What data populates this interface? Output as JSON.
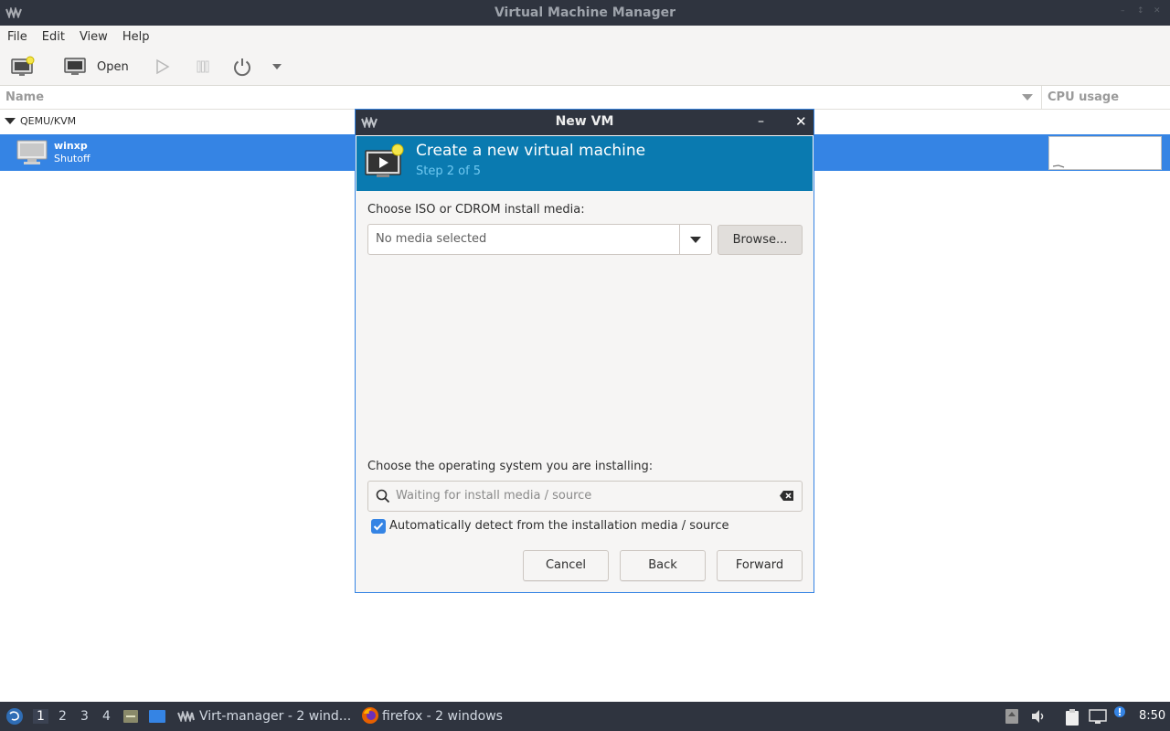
{
  "window": {
    "title": "Virtual Machine Manager"
  },
  "menu": {
    "items": [
      "File",
      "Edit",
      "View",
      "Help"
    ]
  },
  "toolbar": {
    "open_label": "Open"
  },
  "columns": {
    "name": "Name",
    "cpu": "CPU usage"
  },
  "tree": {
    "group": "QEMU/KVM",
    "vm": {
      "name": "winxp",
      "state": "Shutoff"
    }
  },
  "dialog": {
    "title": "New VM",
    "heading": "Create a new virtual machine",
    "step": "Step 2 of 5",
    "media_label": "Choose ISO or CDROM install media:",
    "media_value": "No media selected",
    "browse_label": "Browse...",
    "os_label": "Choose the operating system you are installing:",
    "os_placeholder": "Waiting for install media / source",
    "autodetect_label": "Automatically detect from the installation media / source",
    "autodetect_checked": true,
    "cancel_label": "Cancel",
    "back_label": "Back",
    "forward_label": "Forward"
  },
  "taskbar": {
    "workspaces": [
      "1",
      "2",
      "3",
      "4"
    ],
    "active_workspace": "1",
    "tasks": [
      {
        "label": "Virt-manager - 2 wind..."
      },
      {
        "label": "firefox - 2 windows"
      }
    ],
    "clock": "8:50"
  },
  "colors": {
    "titlebar": "#2f343f",
    "selection": "#3584e4",
    "banner": "#0a7ab0",
    "banner_step": "#6fc8f0"
  }
}
